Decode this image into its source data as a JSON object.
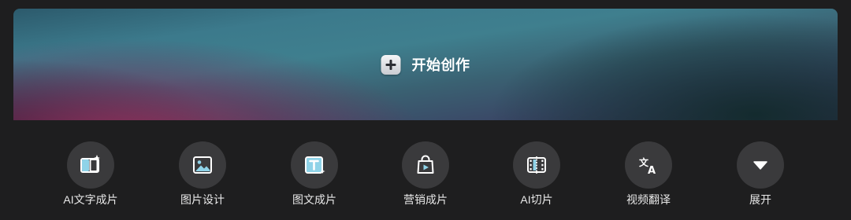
{
  "hero": {
    "label": "开始创作",
    "icon": "plus-icon"
  },
  "tools": [
    {
      "label": "AI文字成片",
      "icon": "book-sparkle-icon"
    },
    {
      "label": "图片设计",
      "icon": "image-icon"
    },
    {
      "label": "图文成片",
      "icon": "text-box-sparkle-icon"
    },
    {
      "label": "营销成片",
      "icon": "shopping-bag-play-icon"
    },
    {
      "label": "AI切片",
      "icon": "film-split-icon"
    },
    {
      "label": "视频翻译",
      "icon": "translate-icon"
    },
    {
      "label": "展开",
      "icon": "triangle-down-icon"
    }
  ],
  "colors": {
    "background": "#1e1e1f",
    "tool_circle": "#3a3a3c",
    "icon_accent": "#8fd3e8",
    "text": "#e8e8e8"
  }
}
